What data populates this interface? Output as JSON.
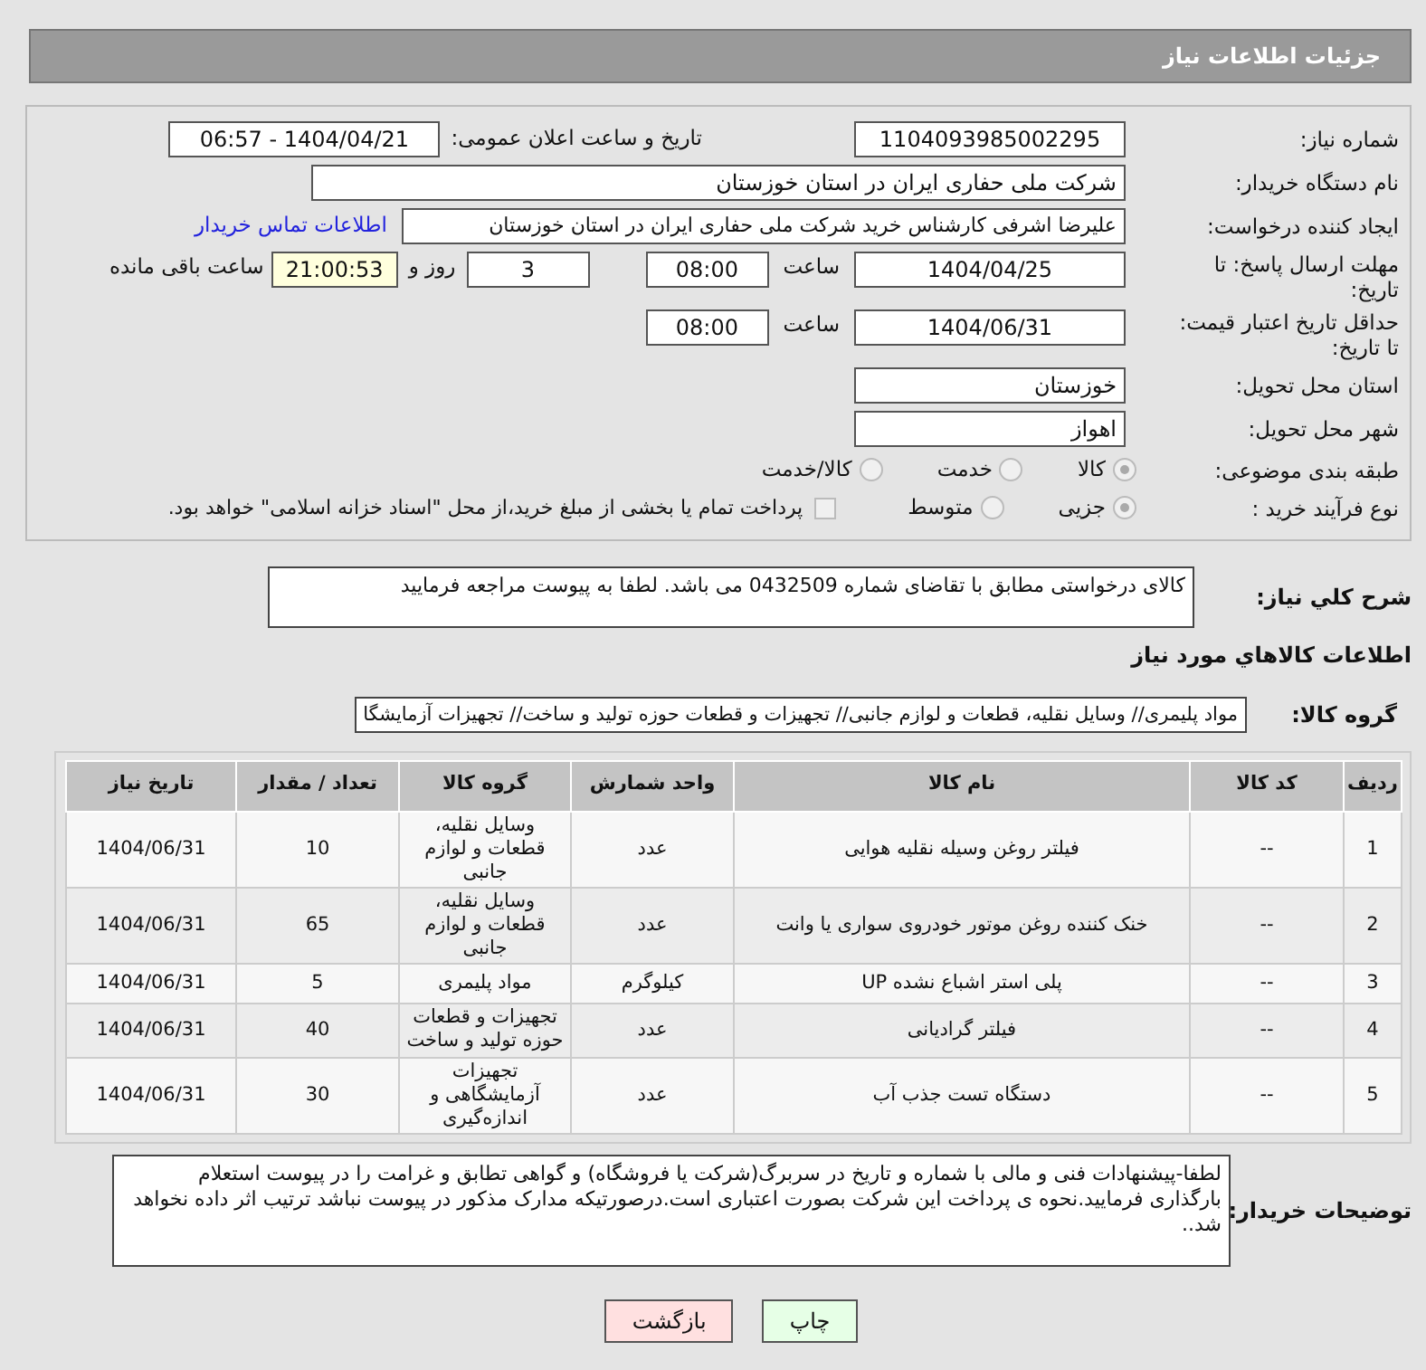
{
  "header": {
    "title": "جزئیات اطلاعات نیاز"
  },
  "need_number": {
    "label": "شماره نیاز:",
    "value": "1104093985002295"
  },
  "announce": {
    "label": "تاریخ و ساعت اعلان عمومی:",
    "value": "1404/04/21 - 06:57"
  },
  "buyer_org": {
    "label": "نام دستگاه خریدار:",
    "value": "شرکت ملی حفاری ایران در استان خوزستان"
  },
  "requester": {
    "label": "ایجاد کننده درخواست:",
    "value": "علیرضا اشرفی کارشناس خرید شرکت ملی حفاری ایران در استان خوزستان",
    "link": "اطلاعات تماس خریدار"
  },
  "reply_deadline": {
    "label": "مهلت ارسال پاسخ: تا تاریخ:",
    "date": "1404/04/25",
    "time_label": "ساعت",
    "time": "08:00",
    "days": "3",
    "days_label": "روز و",
    "remaining": "21:00:53",
    "remaining_label": "ساعت باقی مانده"
  },
  "validity": {
    "label": "حداقل تاریخ اعتبار قیمت: تا تاریخ:",
    "date": "1404/06/31",
    "time_label": "ساعت",
    "time": "08:00"
  },
  "province": {
    "label": "استان محل تحویل:",
    "value": "خوزستان"
  },
  "city": {
    "label": "شهر محل تحویل:",
    "value": "اهواز"
  },
  "category": {
    "label": "طبقه بندی موضوعی:",
    "options": [
      {
        "label": "کالا",
        "selected": true
      },
      {
        "label": "خدمت",
        "selected": false
      },
      {
        "label": "کالا/خدمت",
        "selected": false
      }
    ]
  },
  "process": {
    "label": "نوع فرآیند خرید :",
    "options": [
      {
        "label": "جزیی",
        "selected": true
      },
      {
        "label": "متوسط",
        "selected": false
      }
    ],
    "checkbox": {
      "label": "پرداخت تمام یا بخشی از مبلغ خرید،از محل \"اسناد خزانه اسلامی\" خواهد بود.",
      "checked": false
    }
  },
  "description": {
    "label": "شرح کلي نياز:",
    "value": "کالای درخواستی مطابق با تقاضای شماره 0432509 می باشد. لطفا به پیوست مراجعه فرمایید"
  },
  "goods_title": "اطلاعات کالاهاي مورد نياز",
  "group": {
    "label": "گروه کالا:",
    "value": "مواد پلیمری// وسایل نقلیه، قطعات و لوازم جانبی// تجهیزات و قطعات حوزه تولید و ساخت// تجهیزات آزمایشگا"
  },
  "table": {
    "columns": [
      "ردیف",
      "کد کالا",
      "نام کالا",
      "واحد شمارش",
      "گروه کالا",
      "تعداد / مقدار",
      "تاریخ نیاز"
    ],
    "rows": [
      [
        "1",
        "--",
        "فیلتر روغن وسیله نقلیه هوایی",
        "عدد",
        "وسایل نقلیه، قطعات و لوازم جانبی",
        "10",
        "1404/06/31"
      ],
      [
        "2",
        "--",
        "خنک کننده روغن موتور خودروی سواری یا وانت",
        "عدد",
        "وسایل نقلیه، قطعات و لوازم جانبی",
        "65",
        "1404/06/31"
      ],
      [
        "3",
        "--",
        "پلی استر اشباع نشده UP",
        "کیلوگرم",
        "مواد پلیمری",
        "5",
        "1404/06/31"
      ],
      [
        "4",
        "--",
        "فیلتر گرادیانی",
        "عدد",
        "تجهیزات و قطعات حوزه تولید و ساخت",
        "40",
        "1404/06/31"
      ],
      [
        "5",
        "--",
        "دستگاه تست جذب آب",
        "عدد",
        "تجهیزات آزمایشگاهی و اندازه‌گیری",
        "30",
        "1404/06/31"
      ]
    ]
  },
  "buyer_notes": {
    "label": "توضیحات خریدار:",
    "value": "لطفا-پیشنهادات فنی و مالی با شماره و تاریخ در سربرگ(شرکت یا فروشگاه) و گواهی تطابق و غرامت را در پیوست استعلام بارگذاری فرمایید.نحوه ی پرداخت این شرکت بصورت اعتباری است.درصورتیکه مدارک مذکور در پیوست نباشد ترتیب اثر داده نخواهد شد.."
  },
  "buttons": [
    {
      "label": "چاپ",
      "kind": "print"
    },
    {
      "label": "بازگشت",
      "kind": "back"
    }
  ]
}
